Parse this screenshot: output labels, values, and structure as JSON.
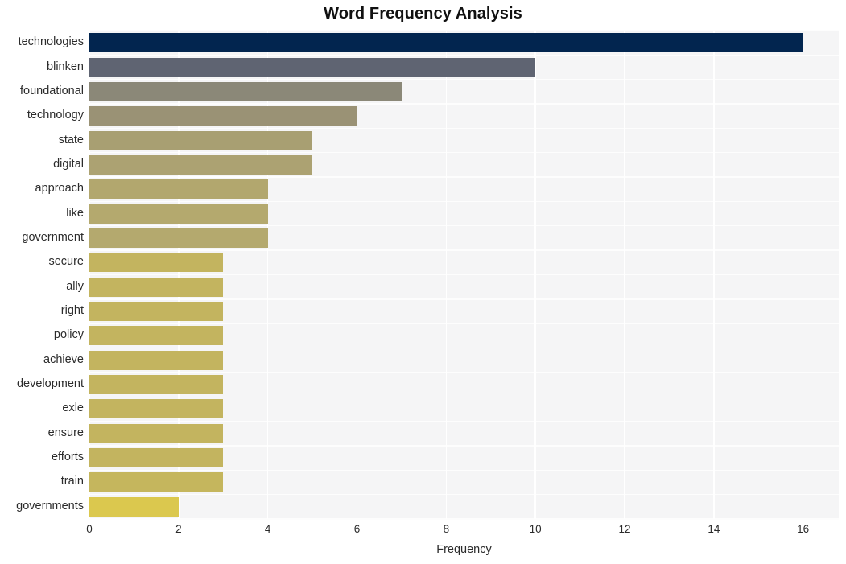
{
  "chart_data": {
    "type": "bar",
    "orientation": "horizontal",
    "title": "Word Frequency Analysis",
    "xlabel": "Frequency",
    "ylabel": "",
    "categories": [
      "technologies",
      "blinken",
      "foundational",
      "technology",
      "state",
      "digital",
      "approach",
      "like",
      "government",
      "secure",
      "ally",
      "right",
      "policy",
      "achieve",
      "development",
      "exle",
      "ensure",
      "efforts",
      "train",
      "governments"
    ],
    "values": [
      16,
      10,
      7,
      6,
      5,
      5,
      4,
      4,
      4,
      3,
      3,
      3,
      3,
      3,
      3,
      3,
      3,
      3,
      3,
      2
    ],
    "bar_colors": [
      "#02254f",
      "#5f6472",
      "#8b8878",
      "#9a9275",
      "#a89f72",
      "#aca272",
      "#b2a76e",
      "#b4a96e",
      "#b4a96e",
      "#c3b45f",
      "#c3b45f",
      "#c3b45f",
      "#c3b45f",
      "#c3b45f",
      "#c3b45f",
      "#c3b45f",
      "#c3b45f",
      "#c3b45f",
      "#c5b65d",
      "#dbc84e"
    ],
    "xticks": [
      "0",
      "2",
      "4",
      "6",
      "8",
      "10",
      "12",
      "14",
      "16"
    ],
    "xtick_values": [
      0,
      2,
      4,
      6,
      8,
      10,
      12,
      14,
      16
    ],
    "xlim": [
      0,
      16.8
    ],
    "grid": true,
    "grid_color": "#ffffff",
    "plot_background": "#f5f5f6",
    "figure_background": "#ffffff",
    "legend": "none"
  }
}
